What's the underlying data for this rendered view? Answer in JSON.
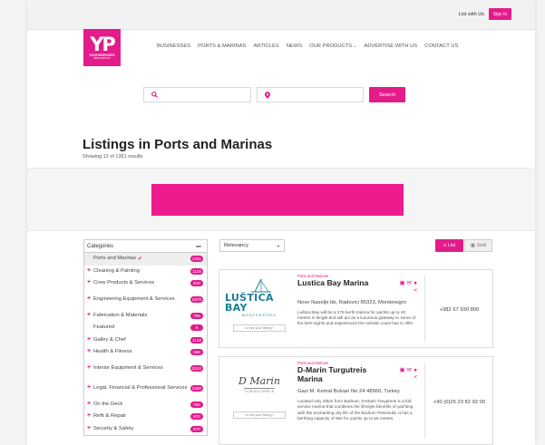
{
  "topbar": {
    "list_with_us": "List with Us",
    "sign_in": "Sign In"
  },
  "logo": {
    "mark": "YP",
    "name": "YACHTINGPAGES",
    "sub": "MEDIA GROUP"
  },
  "nav": {
    "items": [
      "BUSINESSES",
      "PORTS & MARINAS",
      "ARTICLES",
      "NEWS",
      "OUR PRODUCTS",
      "ADVERTISE WITH US",
      "CONTACT US"
    ]
  },
  "search": {
    "keyword_placeholder": "",
    "location_placeholder": "",
    "button_label": "Search"
  },
  "title": {
    "heading": "Listings in Ports and Marinas",
    "count": "Showing 12 of 1351 results"
  },
  "banner": {
    "color": "#ed1b8e"
  },
  "sidebar": {
    "header": "Categories",
    "categories": [
      {
        "label": "Ports and Marinas",
        "count": "1351",
        "plus": false,
        "checked": true,
        "active": true
      },
      {
        "label": "Cleaning & Painting",
        "count": "1118",
        "plus": true
      },
      {
        "label": "Crew Products & Services",
        "count": "819",
        "plus": true
      },
      {
        "label": "Engineering Equipment & Services",
        "count": "2670",
        "plus": true
      },
      {
        "label": "Fabrication & Materials",
        "count": "796",
        "plus": true
      },
      {
        "label": "Featured",
        "count": "6",
        "plus": false
      },
      {
        "label": "Galley & Chef",
        "count": "1133",
        "plus": true
      },
      {
        "label": "Health & Fitness",
        "count": "599",
        "plus": true
      },
      {
        "label": "Interior Equipment & Services",
        "count": "2022",
        "plus": true
      },
      {
        "label": "Legal, Financial & Professional Services",
        "count": "1250",
        "plus": true
      },
      {
        "label": "On the Deck",
        "count": "782",
        "plus": true
      },
      {
        "label": "Refit & Repair",
        "count": "670",
        "plus": true
      },
      {
        "label": "Security & Safety",
        "count": "670",
        "plus": true
      }
    ]
  },
  "sort": {
    "selected": "Relevancy"
  },
  "view": {
    "list_label": "List",
    "grid_label": "Grid"
  },
  "listings": [
    {
      "category": "Ports and Marinas",
      "title": "Lustica Bay Marina",
      "address": "Novo Naselje bb, Radovici 85323, Montenegro",
      "description": "Luštica Bay will be a 176 berth marina for yachts up to 40 metres in length and will act as a luxurious gateway to some of the best sights and experiences the Adriatic coast has to offer.",
      "phone": "+382 67 930 800",
      "claim": "Is this your listing?",
      "logo_main": "LUŠTICA BAY",
      "logo_sub": "MONTENEGRO"
    },
    {
      "category": "Ports and Marinas",
      "title": "D-Marin Turgutreis Marina",
      "address": "Gazi M. Kemal Bulvari No.24 48960, Turkey",
      "description": "Located only 20km from Bodrum, D-Marin Turgutreis is a full-service marina that combines the lifestyle benefits of yachting with the enchanting city life of the Bodrum Peninsula. It has a berthing capacity of 550 for yachts up to 65 metres.",
      "phone": "+90 (0)25 23 82 92 00",
      "claim": "Is this your listing?",
      "logo_main": "D Marin",
      "logo_sub": "TURGUTREIS"
    }
  ],
  "colors": {
    "accent": "#e31b8b",
    "teal": "#1d7f95"
  }
}
